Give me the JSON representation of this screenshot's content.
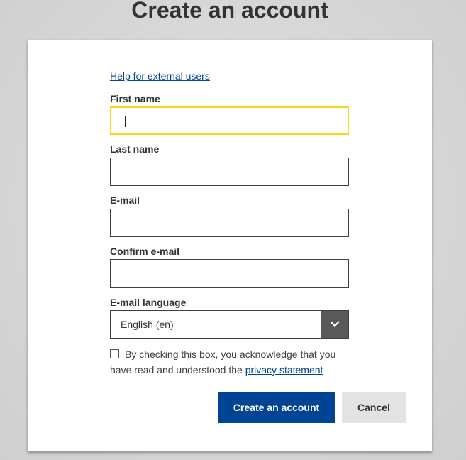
{
  "page": {
    "title": "Create an account"
  },
  "form": {
    "help_link": "Help for external users",
    "fields": [
      {
        "label": "First name",
        "value": "",
        "placeholder": "",
        "focused": true
      },
      {
        "label": "Last name",
        "value": "",
        "placeholder": ""
      },
      {
        "label": "E-mail",
        "value": "",
        "placeholder": ""
      },
      {
        "label": "Confirm e-mail",
        "value": "",
        "placeholder": ""
      }
    ],
    "language": {
      "label": "E-mail language",
      "selected": "English (en)",
      "icon": "chevron-down-icon"
    },
    "consent": {
      "checked": false,
      "text": "By checking this box, you acknowledge that you have read and understood the ",
      "link": "privacy statement"
    },
    "buttons": {
      "submit": "Create an account",
      "cancel": "Cancel"
    }
  },
  "colors": {
    "primary": "#004494",
    "focus": "#ffd617",
    "select_arrow_bg": "#595959"
  }
}
